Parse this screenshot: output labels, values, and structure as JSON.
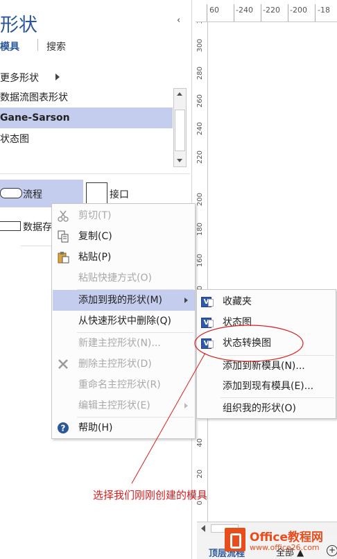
{
  "pane": {
    "title": "形状",
    "collapse_glyph": "‹",
    "tabs": {
      "stencils": "模具",
      "search": "搜索"
    },
    "more_shapes": "更多形状",
    "stencils": [
      {
        "label": "数据流图表形状",
        "selected": false
      },
      {
        "label": "Gane-Sarson",
        "selected": true
      },
      {
        "label": "状态图",
        "selected": false
      }
    ],
    "masters": {
      "flow": "流程",
      "interface": "接口",
      "datastore": "数据存"
    }
  },
  "ruler": {
    "h_ticks": [
      "60",
      "-240",
      "-220",
      "-200",
      "-18"
    ],
    "v_ticks": [
      "3",
      "300",
      "280",
      "260",
      "240",
      "220",
      "200",
      "180",
      "160",
      "140",
      "120",
      "100",
      "80",
      "60",
      "40",
      "20",
      "0"
    ]
  },
  "status": {
    "page_tab": "顶层流程",
    "all_tab": "全部 ▲",
    "add_page": "+"
  },
  "context_menu": {
    "items": [
      {
        "label": "剪切(T)",
        "disabled": true,
        "icon": "scissors-icon"
      },
      {
        "label": "复制(C)",
        "disabled": false,
        "icon": "copy-icon"
      },
      {
        "label": "粘贴(P)",
        "disabled": false,
        "icon": "paste-icon"
      },
      {
        "label": "粘贴快捷方式(O)",
        "disabled": true,
        "icon": ""
      },
      {
        "label": "添加到我的形状(M)",
        "disabled": false,
        "icon": "",
        "highlighted": true,
        "submenu": true
      },
      {
        "label": "从快速形状中删除(Q)",
        "disabled": false,
        "icon": ""
      },
      {
        "label": "新建主控形状(N)...",
        "disabled": true,
        "icon": ""
      },
      {
        "label": "删除主控形状(D)",
        "disabled": true,
        "icon": "delete-x-icon"
      },
      {
        "label": "重命名主控形状(R)",
        "disabled": true,
        "icon": ""
      },
      {
        "label": "编辑主控形状(E)",
        "disabled": true,
        "icon": "",
        "submenu": true
      },
      {
        "label": "帮助(H)",
        "disabled": false,
        "icon": "help-icon"
      }
    ]
  },
  "submenu": {
    "items": [
      {
        "label": "收藏夹",
        "icon": "visio-stencil-icon"
      },
      {
        "label": "状态图",
        "icon": "visio-stencil-icon"
      },
      {
        "label": "状态转换图",
        "icon": "visio-stencil-icon"
      },
      {
        "label": "添加到新模具(N)...",
        "icon": ""
      },
      {
        "label": "添加到现有模具(E)...",
        "icon": ""
      },
      {
        "label": "组织我的形状(O)",
        "icon": ""
      }
    ]
  },
  "annotation": {
    "text": "选择我们刚刚创建的模具",
    "color": "#d81e1e"
  },
  "watermark": {
    "brand": "Office教程网",
    "url": "www.office26.com"
  },
  "colors": {
    "accent": "#2b579a",
    "highlight": "#c5cdee",
    "annotation": "#d81e1e",
    "logo": "#e84d1c"
  }
}
